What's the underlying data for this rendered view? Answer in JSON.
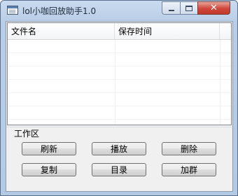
{
  "window": {
    "title": "lol小咖回放助手1.0",
    "controls": {
      "minimize": "minimize",
      "maximize": "maximize",
      "close": "✕"
    }
  },
  "listview": {
    "columns": [
      "文件名",
      "保存时间",
      ""
    ],
    "rows": []
  },
  "workarea": {
    "label": "工作区",
    "buttons": {
      "refresh": "刷新",
      "play": "播放",
      "delete": "删除",
      "copy": "复制",
      "directory": "目录",
      "join_group": "加群"
    }
  },
  "colors": {
    "title_bar": "#b9cde6",
    "close_button": "#c0392b",
    "client_bg": "#f0f0f0"
  }
}
